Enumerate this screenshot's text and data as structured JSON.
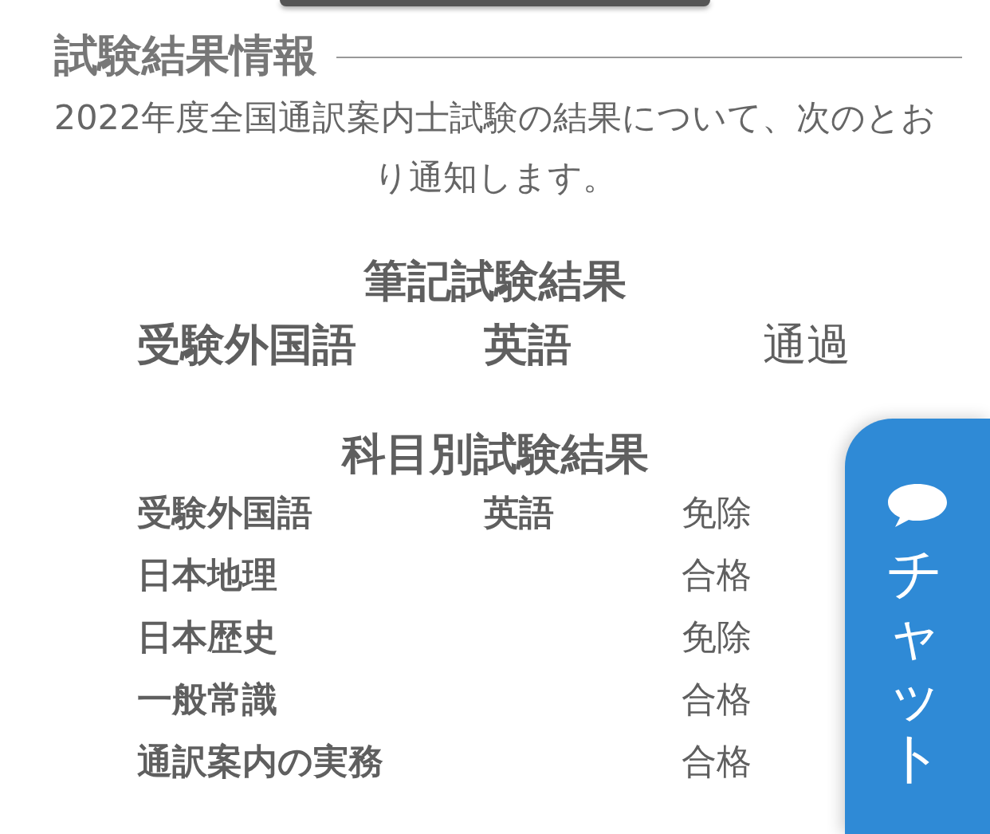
{
  "section_title": "試験結果情報",
  "intro": "2022年度全国通訳案内士試験の結果について、次のとおり通知します。",
  "written_exam": {
    "title": "筆記試験結果",
    "rows": [
      {
        "subject": "受験外国語",
        "language": "英語",
        "result": "通過"
      }
    ]
  },
  "subject_exam": {
    "title": "科目別試験結果",
    "rows": [
      {
        "subject": "受験外国語",
        "language": "英語",
        "result": "免除"
      },
      {
        "subject": "日本地理",
        "result": "合格"
      },
      {
        "subject": "日本歴史",
        "result": "免除"
      },
      {
        "subject": "一般常識",
        "result": "合格"
      },
      {
        "subject": "通訳案内の実務",
        "result": "合格"
      }
    ]
  },
  "chat_tab": {
    "label": "チャット"
  }
}
